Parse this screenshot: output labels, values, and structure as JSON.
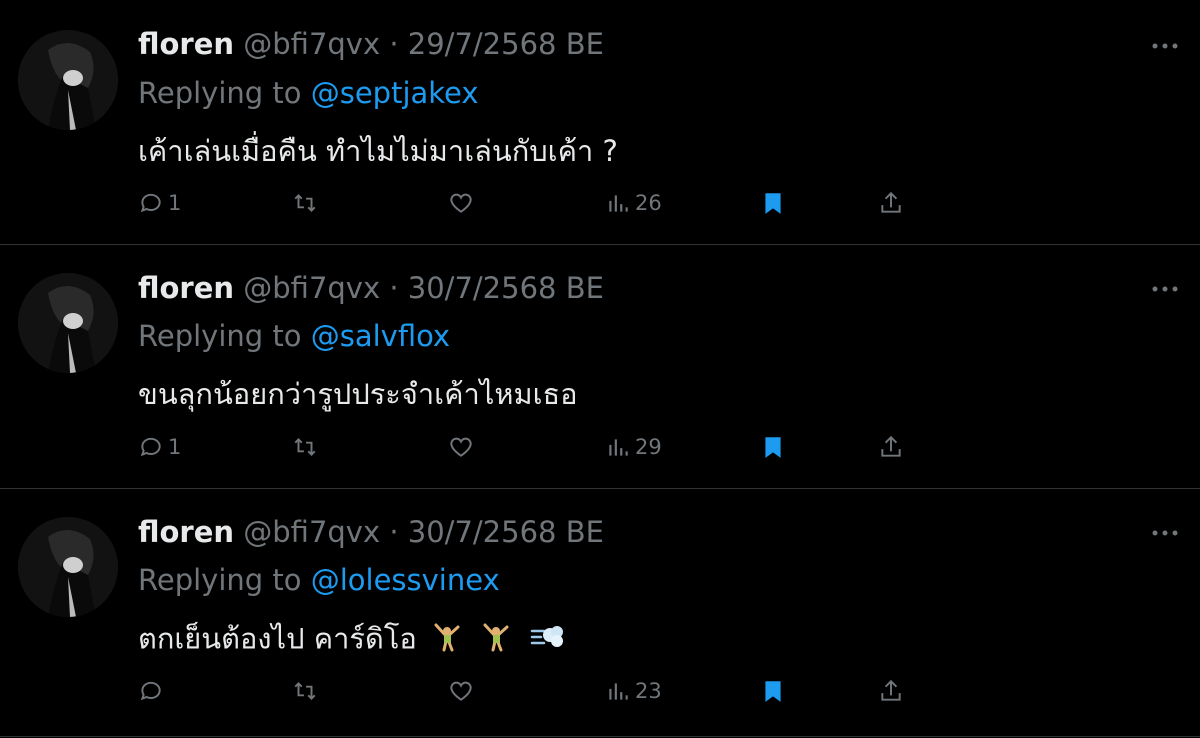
{
  "colors": {
    "background": "#000000",
    "text": "#e7e9ea",
    "muted": "#71767b",
    "link": "#1d9bf0",
    "bookmark": "#1d9bf0",
    "divider": "#2f3336"
  },
  "tweets": [
    {
      "name": "floren",
      "handle": "@bfi7qvx",
      "date": "29/7/2568 BE",
      "replying_label": "Replying to",
      "replying_to": "@septjakex",
      "text": "เค้าเล่นเมื่อคืน ทำไมไม่มาเล่นกับเค้า ?",
      "replies": "1",
      "retweets": "",
      "likes": "",
      "views": "26",
      "bookmarked": true
    },
    {
      "name": "floren",
      "handle": "@bfi7qvx",
      "date": "30/7/2568 BE",
      "replying_label": "Replying to",
      "replying_to": "@salvflox",
      "text": "ขนลุกน้อยกว่ารูปประจำเค้าไหมเธอ",
      "replies": "1",
      "retweets": "",
      "likes": "",
      "views": "29",
      "bookmarked": true
    },
    {
      "name": "floren",
      "handle": "@bfi7qvx",
      "date": "30/7/2568 BE",
      "replying_label": "Replying to",
      "replying_to": "@lolessvinex",
      "text": "ตกเย็นต้องไป คาร์ดิโอ",
      "emojis": [
        "person-cartwheeling",
        "person-cartwheeling",
        "dashing-away"
      ],
      "replies": "",
      "retweets": "",
      "likes": "",
      "views": "23",
      "bookmarked": true
    }
  ]
}
